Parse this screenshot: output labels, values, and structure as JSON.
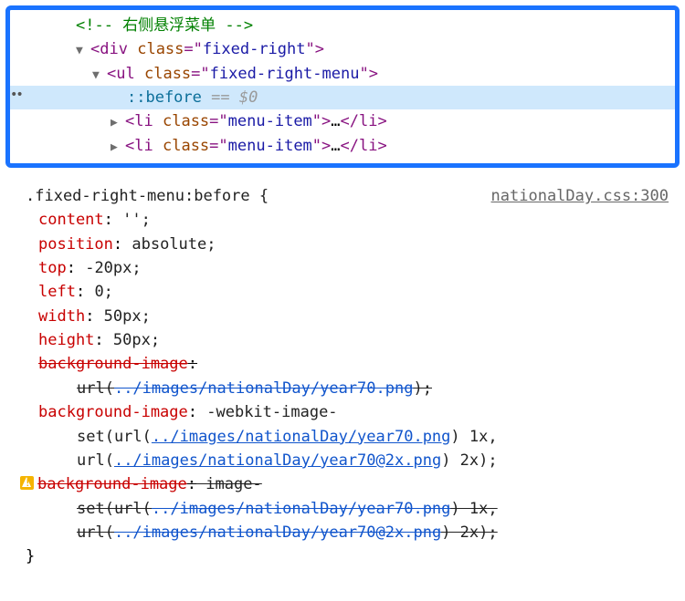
{
  "dom": {
    "comment_open": "<!-- ",
    "comment_text": "右侧悬浮菜单",
    "comment_close": " -->",
    "div_tag": "div",
    "ul_tag": "ul",
    "li_tag": "li",
    "attr_class": "class",
    "eq": "=",
    "q": "\"",
    "div_class": "fixed-right",
    "ul_class": "fixed-right-menu",
    "li_class": "menu-item",
    "pseudo": "::before",
    "eqeq": " == ",
    "var": "$0",
    "lt": "<",
    "gt": ">",
    "lts": "</",
    "ellipsis": "…"
  },
  "css": {
    "selector": ".fixed-right-menu:before",
    "brace_open": " {",
    "brace_close": "}",
    "source": "nationalDay.css:300",
    "props": {
      "content": "content",
      "position": "position",
      "top": "top",
      "left": "left",
      "width": "width",
      "height": "height",
      "bgimg": "background-image"
    },
    "vals": {
      "content": " '';",
      "position": " absolute;",
      "top": " -20px;",
      "left": " 0;",
      "width": " 50px;",
      "height": " 50px;"
    },
    "url_prefix": "url(",
    "url_suffix": ")",
    "path1": "../images/nationalDay/year70.png",
    "path2": "../images/nationalDay/year70@2x.png",
    "webkit_pre": " -webkit-image-",
    "set_line2a": "set(url(",
    "one_x": ") 1x,",
    "two_x": ") 2x);",
    "imageset_pre": " image-",
    "semi": ";",
    "colon": ":"
  }
}
